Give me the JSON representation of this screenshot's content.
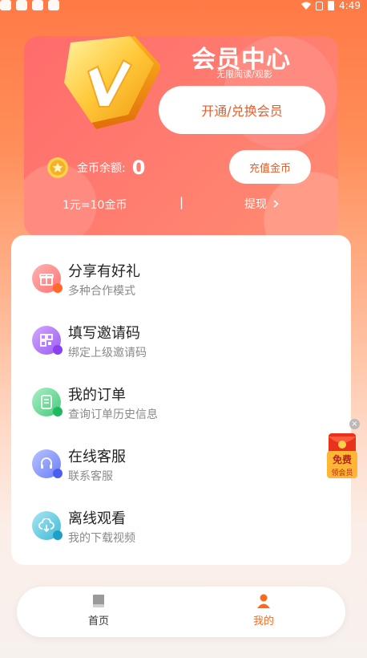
{
  "status_bar": {
    "time": "4:49"
  },
  "member": {
    "title": "会员中心",
    "subtitle": "无限阅读/观影",
    "open_button": "开通/兑换会员",
    "coin_label": "金币余额:",
    "coin_value": "0",
    "recharge_button": "充值金币",
    "rate": "1元=10金币",
    "separator": "|",
    "withdraw": "提现"
  },
  "menu": [
    {
      "title": "分享有好礼",
      "subtitle": "多种合作模式",
      "icon": "gift-icon",
      "color": "#ff7d7d"
    },
    {
      "title": "填写邀请码",
      "subtitle": "绑定上级邀请码",
      "icon": "invite-code-icon",
      "color": "#a06bf2"
    },
    {
      "title": "我的订单",
      "subtitle": "查询订单历史信息",
      "icon": "order-icon",
      "color": "#4fd086"
    },
    {
      "title": "在线客服",
      "subtitle": "联系客服",
      "icon": "headset-icon",
      "color": "#6a7ef7"
    },
    {
      "title": "离线观看",
      "subtitle": "我的下载视频",
      "icon": "download-cloud-icon",
      "color": "#3fb9d6"
    }
  ],
  "float_gift": {
    "line1": "免费",
    "line2": "领会员"
  },
  "bottom_nav": [
    {
      "label": "首页",
      "active": false
    },
    {
      "label": "我的",
      "active": true
    }
  ],
  "colors": {
    "accent": "#ff6b3d",
    "active_nav": "#ff6a1a",
    "inactive_nav": "#333333"
  }
}
